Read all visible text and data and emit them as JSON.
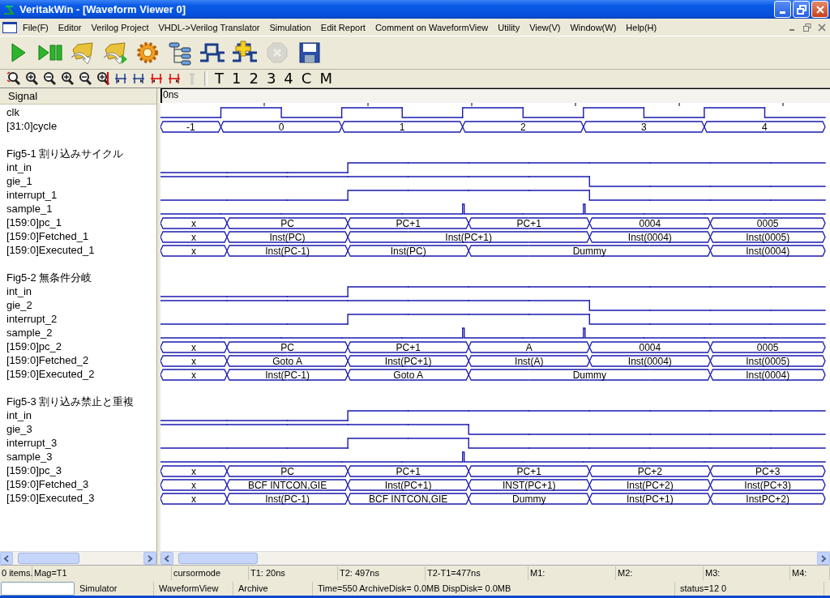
{
  "window": {
    "title": "VeritakWin - [Waveform Viewer 0]"
  },
  "menu": [
    "File(F)",
    "Editor",
    "Verilog Project",
    "VHDL->Verilog Translator",
    "Simulation",
    "Edit Report",
    "Comment on WaveformView",
    "Utility",
    "View(V)",
    "Window(W)",
    "Help(H)"
  ],
  "toolbar": [
    {
      "kind": "run",
      "disabled": false
    },
    {
      "kind": "run-pause",
      "disabled": false
    },
    {
      "kind": "open-folder",
      "disabled": false
    },
    {
      "kind": "open-folder-run",
      "disabled": false
    },
    {
      "kind": "gear",
      "disabled": false
    },
    {
      "kind": "hierarchy",
      "disabled": false
    },
    {
      "kind": "waveform",
      "disabled": false
    },
    {
      "kind": "waveform-add",
      "disabled": false
    },
    {
      "kind": "stop",
      "disabled": true
    },
    {
      "kind": "save",
      "disabled": false
    }
  ],
  "viewbar": {
    "icons": [
      {
        "kind": "zoom-fit",
        "disabled": false
      },
      {
        "kind": "zoom-in",
        "disabled": false
      },
      {
        "kind": "zoom-out",
        "disabled": false
      },
      {
        "kind": "zoom-in",
        "disabled": false
      },
      {
        "kind": "zoom-out",
        "disabled": false
      },
      {
        "kind": "zoom-cursor",
        "disabled": false
      },
      {
        "kind": "cursor-left",
        "disabled": false
      },
      {
        "kind": "cursor-right",
        "disabled": false
      },
      {
        "kind": "cursor-left-alt",
        "disabled": false
      },
      {
        "kind": "cursor-right-alt",
        "disabled": false
      },
      {
        "kind": "marker",
        "disabled": true
      }
    ],
    "text_buttons": [
      "T",
      "1",
      "2",
      "3",
      "4",
      "C",
      "M"
    ]
  },
  "signal_header": "Signal",
  "time_header": "0ns",
  "signals": [
    {
      "name": "clk",
      "kind": "clock",
      "high": [
        false,
        true,
        false,
        true,
        false,
        true,
        false,
        true,
        false,
        true,
        false
      ]
    },
    {
      "name": "[31:0]cycle",
      "kind": "bus",
      "starts": [
        true,
        true,
        false,
        true,
        false,
        true,
        false,
        true,
        false,
        true,
        false
      ],
      "data": [
        "-1",
        "0",
        "1",
        "2",
        "3",
        "4"
      ]
    }
  ],
  "groups": [
    {
      "title": "Fig5-1 割り込みサイクル",
      "signals": [
        {
          "name": "int_in",
          "kind": "bit",
          "high": [
            false,
            false,
            false,
            true,
            true,
            true,
            true,
            true,
            true,
            true,
            true
          ]
        },
        {
          "name": "gie_1",
          "kind": "bit",
          "high": [
            true,
            true,
            true,
            true,
            true,
            true,
            true,
            false,
            false,
            false,
            false
          ]
        },
        {
          "name": "interrupt_1",
          "kind": "bit",
          "high": [
            false,
            false,
            false,
            true,
            true,
            true,
            true,
            false,
            false,
            false,
            false
          ]
        },
        {
          "name": "sample_1",
          "kind": "pulse",
          "pulse": [
            false,
            false,
            false,
            false,
            false,
            true,
            false,
            true,
            false,
            false,
            false
          ]
        },
        {
          "name": "[159:0]pc_1",
          "kind": "bus",
          "starts": [
            true,
            true,
            false,
            true,
            false,
            true,
            false,
            true,
            false,
            true,
            false
          ],
          "data": [
            "x",
            "PC",
            "PC+1",
            "PC+1",
            "0004",
            "0005"
          ]
        },
        {
          "name": "[159:0]Fetched_1",
          "kind": "bus",
          "starts": [
            true,
            true,
            false,
            true,
            false,
            false,
            false,
            true,
            false,
            true,
            false
          ],
          "data": [
            "x",
            "Inst(PC)",
            "Inst(PC+1)",
            "Inst(0004)",
            "Inst(0005)"
          ]
        },
        {
          "name": "[159:0]Executed_1",
          "kind": "bus",
          "starts": [
            true,
            true,
            false,
            true,
            false,
            true,
            false,
            false,
            false,
            true,
            false
          ],
          "data": [
            "x",
            "Inst(PC-1)",
            "Inst(PC)",
            "Dummy",
            "Inst(0004)"
          ]
        }
      ]
    },
    {
      "title": "Fig5-2 無条件分岐",
      "signals": [
        {
          "name": "int_in",
          "kind": "bit",
          "high": [
            false,
            false,
            false,
            true,
            true,
            true,
            true,
            true,
            true,
            true,
            true
          ]
        },
        {
          "name": "gie_2",
          "kind": "bit",
          "high": [
            true,
            true,
            true,
            true,
            true,
            true,
            true,
            false,
            false,
            false,
            false
          ]
        },
        {
          "name": "interrupt_2",
          "kind": "bit",
          "high": [
            false,
            false,
            false,
            true,
            true,
            true,
            true,
            false,
            false,
            false,
            false
          ]
        },
        {
          "name": "sample_2",
          "kind": "pulse",
          "pulse": [
            false,
            false,
            false,
            false,
            false,
            true,
            false,
            true,
            false,
            false,
            false
          ]
        },
        {
          "name": "[159:0]pc_2",
          "kind": "bus",
          "starts": [
            true,
            true,
            false,
            true,
            false,
            true,
            false,
            true,
            false,
            true,
            false
          ],
          "data": [
            "x",
            "PC",
            "PC+1",
            "A",
            "0004",
            "0005"
          ]
        },
        {
          "name": "[159:0]Fetched_2",
          "kind": "bus",
          "starts": [
            true,
            true,
            false,
            true,
            false,
            true,
            false,
            true,
            false,
            true,
            false
          ],
          "data": [
            "x",
            "Goto A",
            "Inst(PC+1)",
            "Inst(A)",
            "Inst(0004)",
            "Inst(0005)"
          ]
        },
        {
          "name": "[159:0]Executed_2",
          "kind": "bus",
          "starts": [
            true,
            true,
            false,
            true,
            false,
            true,
            false,
            false,
            false,
            true,
            false
          ],
          "data": [
            "x",
            "Inst(PC-1)",
            "Goto A",
            "Dummy",
            "Inst(0004)"
          ]
        }
      ]
    },
    {
      "title": "Fig5-3 割り込み禁止と重複",
      "signals": [
        {
          "name": "int_in",
          "kind": "bit",
          "high": [
            false,
            false,
            false,
            true,
            true,
            true,
            true,
            true,
            true,
            true,
            true
          ]
        },
        {
          "name": "gie_3",
          "kind": "bit",
          "high": [
            true,
            true,
            true,
            true,
            true,
            false,
            false,
            false,
            false,
            false,
            false
          ]
        },
        {
          "name": "interrupt_3",
          "kind": "bit",
          "high": [
            false,
            false,
            false,
            true,
            true,
            false,
            false,
            false,
            false,
            false,
            false
          ]
        },
        {
          "name": "sample_3",
          "kind": "pulse",
          "pulse": [
            false,
            false,
            false,
            false,
            false,
            true,
            false,
            false,
            false,
            false,
            false
          ]
        },
        {
          "name": "[159:0]pc_3",
          "kind": "bus",
          "starts": [
            true,
            true,
            false,
            true,
            false,
            true,
            false,
            true,
            false,
            true,
            false
          ],
          "data": [
            "x",
            "PC",
            "PC+1",
            "PC+1",
            "PC+2",
            "PC+3"
          ]
        },
        {
          "name": "[159:0]Fetched_3",
          "kind": "bus",
          "starts": [
            true,
            true,
            false,
            true,
            false,
            true,
            false,
            true,
            false,
            true,
            false
          ],
          "data": [
            "x",
            "BCF INTCON,GIE",
            "Inst(PC+1)",
            "INST(PC+1)",
            "Inst(PC+2)",
            "Inst(PC+3)"
          ]
        },
        {
          "name": "[159:0]Executed_3",
          "kind": "bus",
          "starts": [
            true,
            true,
            false,
            true,
            false,
            true,
            false,
            true,
            false,
            true,
            false
          ],
          "data": [
            "x",
            "Inst(PC-1)",
            "BCF INTCON,GIE",
            "Dummy",
            "Inst(PC+1)",
            "InstPC+2)"
          ]
        }
      ]
    }
  ],
  "status_bar": [
    "0 items.",
    "Mag=T1",
    "cursormode",
    "T1: 20ns",
    "T2: 497ns",
    "T2-T1=477ns",
    "M1:",
    "M2:",
    "M3:",
    "M4:"
  ],
  "task_bar": [
    "Simulator",
    "WaveformView",
    "Archive",
    "Time=550 ArchiveDisk=  0.0MB DispDisk=  0.0MB",
    "status=12 0"
  ]
}
